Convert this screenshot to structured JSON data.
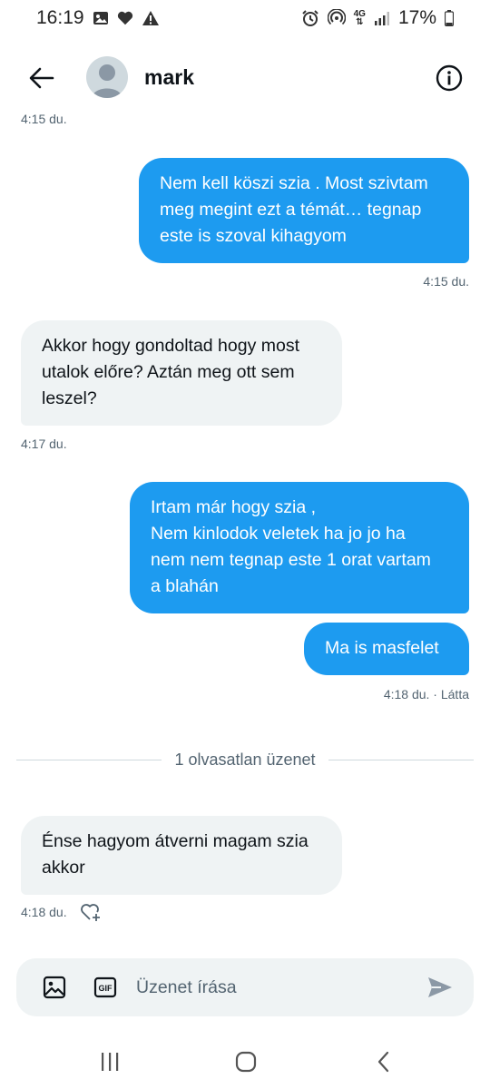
{
  "status_bar": {
    "time": "16:19",
    "network": "4G",
    "battery": "17%"
  },
  "header": {
    "contact_name": "mark"
  },
  "messages": [
    {
      "direction": "in_timestamp_only",
      "time": "4:15 du."
    },
    {
      "direction": "out",
      "lines": [
        "Nem kell köszi szia . Most szivtam",
        "meg megint ezt a témát… tegnap",
        "este is szoval kihagyom"
      ],
      "time": "4:15 du."
    },
    {
      "direction": "in",
      "lines": [
        "Akkor hogy gondoltad hogy most",
        "utalok előre? Aztán meg ott sem",
        "leszel?"
      ],
      "time": "4:17 du."
    },
    {
      "direction": "out",
      "lines": [
        "Irtam már hogy szia ,",
        "Nem kinlodok veletek ha jo jo ha",
        "nem nem tegnap este 1 orat vartam",
        "a blahán"
      ]
    },
    {
      "direction": "out",
      "lines": [
        "Ma is masfelet"
      ],
      "time": "4:18 du. · Látta"
    },
    {
      "direction": "in",
      "lines": [
        "Énse hagyom átverni magam szia",
        "akkor"
      ],
      "time": "4:18 du."
    }
  ],
  "unread_divider": "1 olvasatlan üzenet",
  "composer": {
    "placeholder": "Üzenet írása"
  },
  "colors": {
    "outgoing_bubble": "#1d9bf0",
    "incoming_bubble": "#eff3f4",
    "secondary_text": "#536471"
  },
  "icons": [
    "back-arrow-icon",
    "info-icon",
    "image-icon",
    "gif-icon",
    "send-icon",
    "add-reaction-icon"
  ]
}
